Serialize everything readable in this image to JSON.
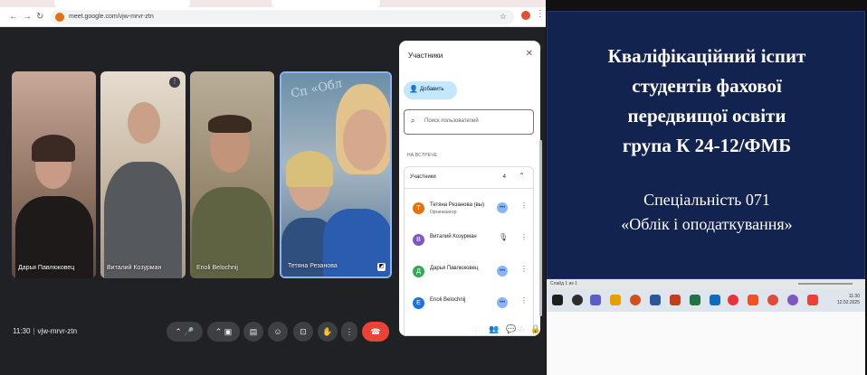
{
  "browser": {
    "url": "meet.google.com/vjw-mrvr-ztn",
    "nav": {
      "back": "←",
      "forward": "→",
      "reload": "↻"
    },
    "star_icon": "☆",
    "menu_icon": "⋮"
  },
  "meet": {
    "people_count": "4",
    "tiles": [
      {
        "name": "Дарья Павлюковец"
      },
      {
        "name": "Виталий Козурман"
      },
      {
        "name": "Enoli Belochnij"
      },
      {
        "name": "Тетяна Резанова"
      }
    ],
    "tile_sign": "Сп «Обл",
    "panel": {
      "title": "Участники",
      "add_label": "Добавить",
      "search_placeholder": "Поиск пользователей",
      "section_label": "НА ВСТРЕЧЕ",
      "group_label": "Участники",
      "group_count": "4",
      "participants": [
        {
          "initial": "Т",
          "name": "Тетяна Резанова (вы)",
          "role": "Организатор",
          "color": "#e8710a"
        },
        {
          "initial": "В",
          "name": "Виталий Козурман",
          "role": "",
          "color": "#7e57c2"
        },
        {
          "initial": "Д",
          "name": "Дарья Павлюковец",
          "role": "",
          "color": "#34a853"
        },
        {
          "initial": "E",
          "name": "Enoli Belochnij",
          "role": "",
          "color": "#1a73e8"
        }
      ]
    },
    "bottom": {
      "time": "11:30",
      "separator": "|",
      "meeting_code": "vjw-mrvr-ztn"
    }
  },
  "presentation": {
    "title_lines": [
      "Кваліфікаційний іспит",
      "студентів фахової",
      "передвищої освіти",
      "група К 24-12/ФМБ"
    ],
    "subtitle_lines": [
      "Спеціальність 071",
      "«Облік і оподаткування»"
    ],
    "status_text": "Слайд 1 из 1",
    "taskbar_time": "11:30",
    "taskbar_date": "12.02.2025"
  }
}
